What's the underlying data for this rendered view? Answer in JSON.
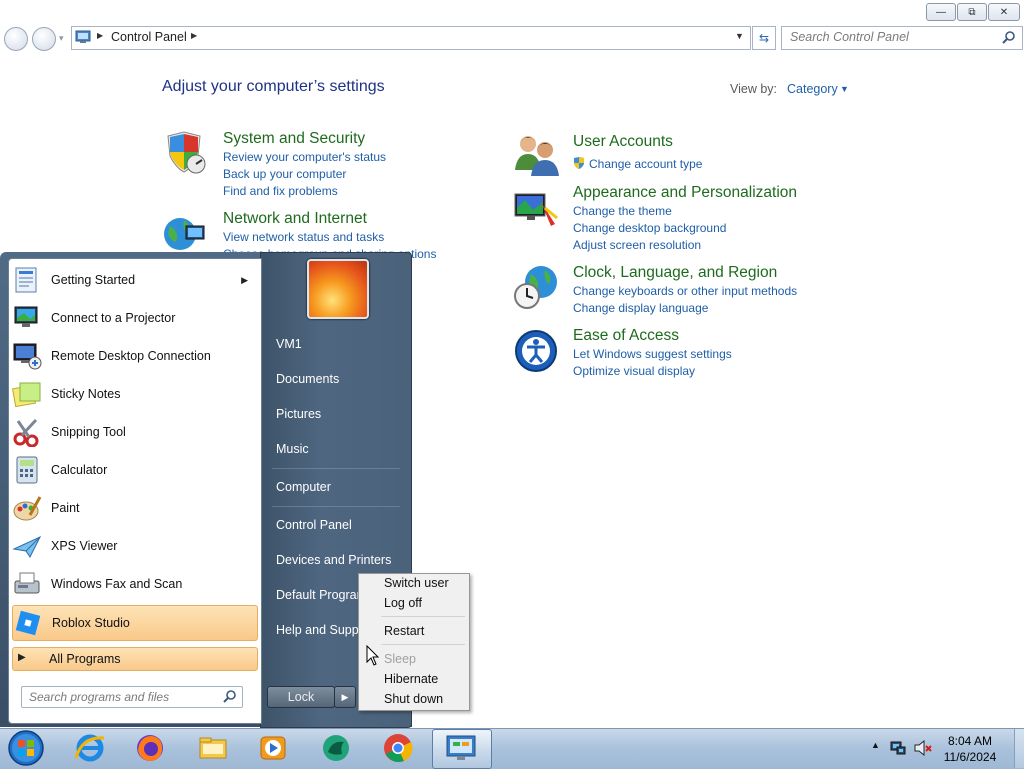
{
  "window": {
    "minimize_glyph": "—",
    "restore_glyph": "⧉",
    "close_glyph": "✕"
  },
  "address": {
    "path": "Control Panel",
    "search_placeholder": "Search Control Panel"
  },
  "content": {
    "heading": "Adjust your computer’s settings",
    "view_by_label": "View by:",
    "view_by_value": "Category",
    "categories": [
      {
        "title": "System and Security",
        "icon": "shield-icon",
        "links": [
          "Review your computer's status",
          "Back up your computer",
          "Find and fix problems"
        ]
      },
      {
        "title": "Network and Internet",
        "icon": "globe-network-icon",
        "links": [
          "View network status and tasks",
          "Choose homegroup and sharing options"
        ]
      },
      {
        "title": "User Accounts",
        "icon": "users-icon",
        "links": [
          "Change account type"
        ]
      },
      {
        "title": "Appearance and Personalization",
        "icon": "monitor-paint-icon",
        "links": [
          "Change the theme",
          "Change desktop background",
          "Adjust screen resolution"
        ]
      },
      {
        "title": "Clock, Language, and Region",
        "icon": "clock-globe-icon",
        "links": [
          "Change keyboards or other input methods",
          "Change display language"
        ]
      },
      {
        "title": "Ease of Access",
        "icon": "ease-of-access-icon",
        "links": [
          "Let Windows suggest settings",
          "Optimize visual display"
        ]
      }
    ]
  },
  "start_menu": {
    "programs": [
      {
        "label": "Getting Started",
        "icon": "getting-started-icon",
        "has_submenu": true
      },
      {
        "label": "Connect to a Projector",
        "icon": "projector-icon"
      },
      {
        "label": "Remote Desktop Connection",
        "icon": "remote-desktop-icon"
      },
      {
        "label": "Sticky Notes",
        "icon": "sticky-notes-icon"
      },
      {
        "label": "Snipping Tool",
        "icon": "scissors-icon"
      },
      {
        "label": "Calculator",
        "icon": "calculator-icon"
      },
      {
        "label": "Paint",
        "icon": "paint-palette-icon"
      },
      {
        "label": "XPS Viewer",
        "icon": "xps-viewer-icon"
      },
      {
        "label": "Windows Fax and Scan",
        "icon": "fax-icon"
      },
      {
        "label": "Roblox Studio",
        "icon": "roblox-studio-icon",
        "highlighted": true
      }
    ],
    "all_programs": "All Programs",
    "search_placeholder": "Search programs and files",
    "right_items": [
      "VM1",
      "Documents",
      "Pictures",
      "Music",
      "Computer",
      "Control Panel",
      "Devices and Printers",
      "Default Programs",
      "Help and Support"
    ],
    "lock_label": "Lock"
  },
  "power_menu": {
    "items": [
      {
        "label": "Switch user",
        "enabled": true
      },
      {
        "label": "Log off",
        "enabled": true
      },
      {
        "label": "Restart",
        "enabled": true
      },
      {
        "label": "Sleep",
        "enabled": false
      },
      {
        "label": "Hibernate",
        "enabled": true
      },
      {
        "label": "Shut down",
        "enabled": true
      }
    ]
  },
  "taskbar": {
    "pinned": [
      "start-orb-icon",
      "internet-explorer-icon",
      "firefox-icon",
      "file-explorer-icon",
      "media-player-icon",
      "app-icon",
      "chrome-icon",
      "control-panel-icon"
    ],
    "time": "8:04 AM",
    "date": "11/6/2024"
  },
  "colors": {
    "heading": "#1e3287",
    "category_title": "#1e6b1e",
    "link": "#1f5fa8",
    "highlight": "#f9c98a"
  }
}
